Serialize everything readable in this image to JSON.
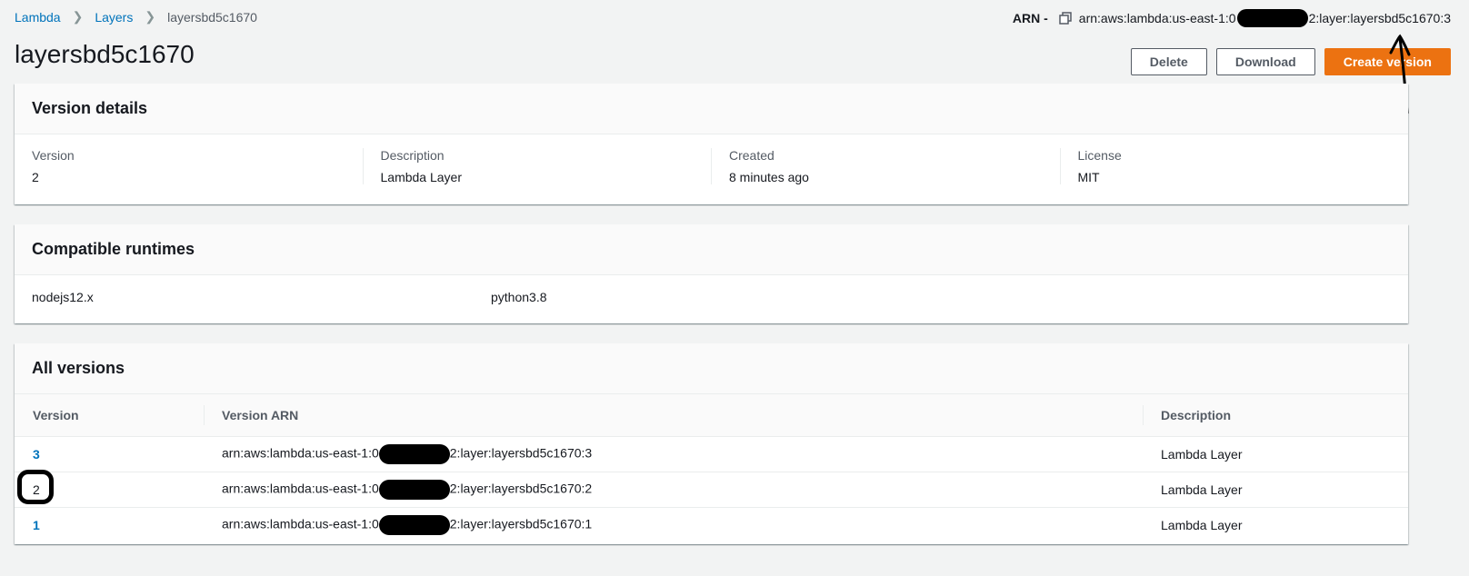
{
  "breadcrumb": {
    "items": [
      "Lambda",
      "Layers"
    ],
    "current": "layersbd5c1670"
  },
  "arn": {
    "label": "ARN -",
    "prefix": "arn:aws:lambda:us-east-1:0",
    "suffix": "2:layer:layersbd5c1670:3"
  },
  "page": {
    "title": "layersbd5c1670"
  },
  "actions": {
    "delete": "Delete",
    "download": "Download",
    "create_version": "Create version"
  },
  "version_details": {
    "title": "Version details",
    "fields": [
      {
        "label": "Version",
        "value": "2"
      },
      {
        "label": "Description",
        "value": "Lambda Layer"
      },
      {
        "label": "Created",
        "value": "8 minutes ago"
      },
      {
        "label": "License",
        "value": "MIT"
      }
    ]
  },
  "runtimes": {
    "title": "Compatible runtimes",
    "items": [
      "nodejs12.x",
      "python3.8"
    ]
  },
  "all_versions": {
    "title": "All versions",
    "columns": [
      "Version",
      "Version ARN",
      "Description"
    ],
    "rows": [
      {
        "version": "3",
        "arn_prefix": "arn:aws:lambda:us-east-1:0",
        "arn_suffix": "2:layer:layersbd5c1670:3",
        "description": "Lambda Layer"
      },
      {
        "version": "2",
        "arn_prefix": "arn:aws:lambda:us-east-1:0",
        "arn_suffix": "2:layer:layersbd5c1670:2",
        "description": "Lambda Layer"
      },
      {
        "version": "1",
        "arn_prefix": "arn:aws:lambda:us-east-1:0",
        "arn_suffix": "2:layer:layersbd5c1670:1",
        "description": "Lambda Layer"
      }
    ]
  },
  "colors": {
    "link": "#0073bb",
    "primary": "#ec7211",
    "background": "#f2f3f3"
  }
}
